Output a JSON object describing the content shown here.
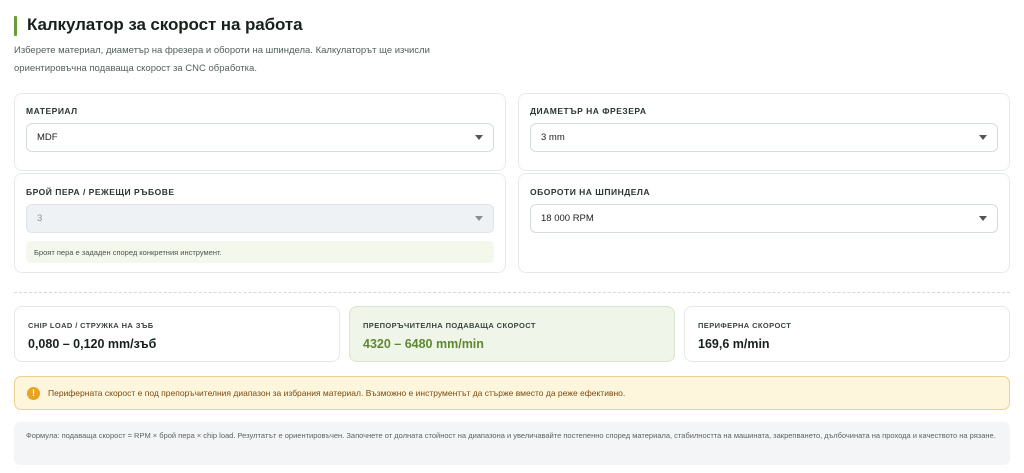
{
  "header": {
    "title": "Калкулатор за скорост на работа",
    "description": "Изберете материал, диаметър на фрезера и обороти на шпиндела. Калкулаторът ще изчисли ориентировъчна подаваща скорост за CNC обработка."
  },
  "fields": {
    "material": {
      "label": "МАТЕРИАЛ",
      "value": "MDF"
    },
    "diameter": {
      "label": "ДИАМЕТЪР НА ФРЕЗЕРА",
      "value": "3 mm"
    },
    "flutes": {
      "label": "БРОЙ ПЕРА / РЕЖЕЩИ РЪБОВЕ",
      "value": "3",
      "hint": "Броят пера е зададен според конкретния инструмент."
    },
    "rpm": {
      "label": "ОБОРОТИ НА ШПИНДЕЛА",
      "value": "18 000 RPM"
    }
  },
  "results": {
    "chip_load": {
      "label": "CHIP LOAD / СТРУЖКА НА ЗЪБ",
      "value": "0,080 – 0,120 mm/зъб"
    },
    "feed_rate": {
      "label": "ПРЕПОРЪЧИТЕЛНА ПОДАВАЩА СКОРОСТ",
      "value": "4320 – 6480 mm/min"
    },
    "surface_speed": {
      "label": "ПЕРИФЕРНА СКОРОСТ",
      "value": "169,6 m/min"
    }
  },
  "warning": {
    "icon": "exclamation-icon",
    "text": "Периферната скорост е под препоръчителния диапазон за избрания материал. Възможно е инструментът да стърже вместо да реже ефективно."
  },
  "formula": "Формула: подаваща скорост = RPM × брой пера × chip load. Резултатът е ориентировъчен. Започнете от долната стойност на диапазона и увеличавайте постепенно според материала, стабилността на машината, закрепването, дълбочината на прохода и качеството на рязане.",
  "colors": {
    "accent": "#6b9a3a",
    "warning_bg": "#fdf6dd",
    "warning_icon": "#e8a323",
    "highlight_value": "#5d8a2e"
  }
}
